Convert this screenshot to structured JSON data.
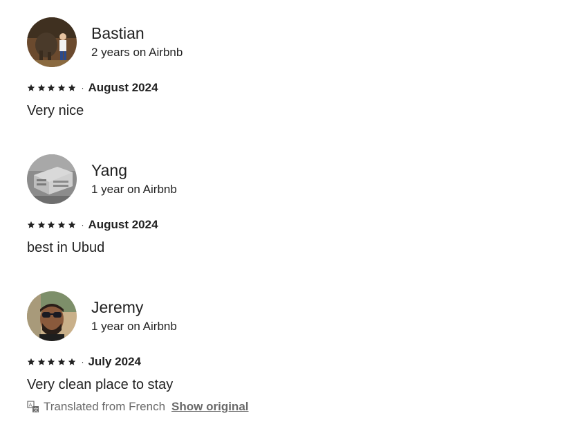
{
  "reviews": [
    {
      "name": "Bastian",
      "tenure": "2 years on Airbnb",
      "rating": 5,
      "separator": "·",
      "date": "August 2024",
      "text": "Very nice"
    },
    {
      "name": "Yang",
      "tenure": "1 year on Airbnb",
      "rating": 5,
      "separator": "·",
      "date": "August 2024",
      "text": "best in Ubud"
    },
    {
      "name": "Jeremy",
      "tenure": "1 year on Airbnb",
      "rating": 5,
      "separator": "·",
      "date": "July 2024",
      "text": "Very clean place to stay",
      "translation_note": "Translated from French",
      "show_original_label": "Show original"
    }
  ],
  "colors": {
    "text": "#222222",
    "muted": "#6a6a6a"
  },
  "icons": {
    "star": "star-icon",
    "translate": "translate-icon"
  }
}
